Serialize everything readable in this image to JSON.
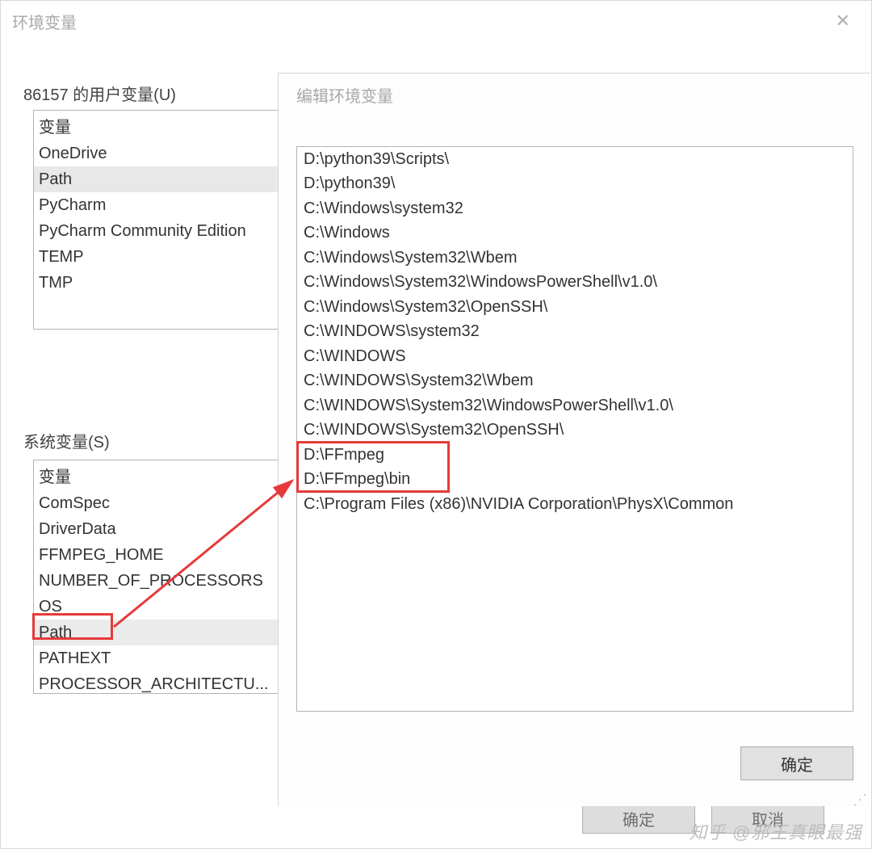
{
  "main_dialog": {
    "title": "环境变量",
    "user_vars_label": "86157 的用户变量(U)",
    "system_vars_label": "系统变量(S)",
    "user_header": "变量",
    "user_rows": [
      "OneDrive",
      "Path",
      "PyCharm",
      "PyCharm Community Edition",
      "TEMP",
      "TMP"
    ],
    "user_selected_index": 1,
    "system_header": "变量",
    "system_rows": [
      "ComSpec",
      "DriverData",
      "FFMPEG_HOME",
      "NUMBER_OF_PROCESSORS",
      "OS",
      "Path",
      "PATHEXT",
      "PROCESSOR_ARCHITECTU..."
    ],
    "system_selected_index": 5,
    "bg_ok": "确定",
    "bg_cancel": "取消"
  },
  "edit_dialog": {
    "title": "编辑环境变量",
    "paths": [
      "D:\\python39\\Scripts\\",
      "D:\\python39\\",
      "C:\\Windows\\system32",
      "C:\\Windows",
      "C:\\Windows\\System32\\Wbem",
      "C:\\Windows\\System32\\WindowsPowerShell\\v1.0\\",
      "C:\\Windows\\System32\\OpenSSH\\",
      "C:\\WINDOWS\\system32",
      "C:\\WINDOWS",
      "C:\\WINDOWS\\System32\\Wbem",
      "C:\\WINDOWS\\System32\\WindowsPowerShell\\v1.0\\",
      "C:\\WINDOWS\\System32\\OpenSSH\\",
      "D:\\FFmpeg",
      "D:\\FFmpeg\\bin",
      "C:\\Program Files (x86)\\NVIDIA Corporation\\PhysX\\Common"
    ],
    "ok_label": "确定"
  },
  "watermark": "知乎  @邪王真眼最强"
}
